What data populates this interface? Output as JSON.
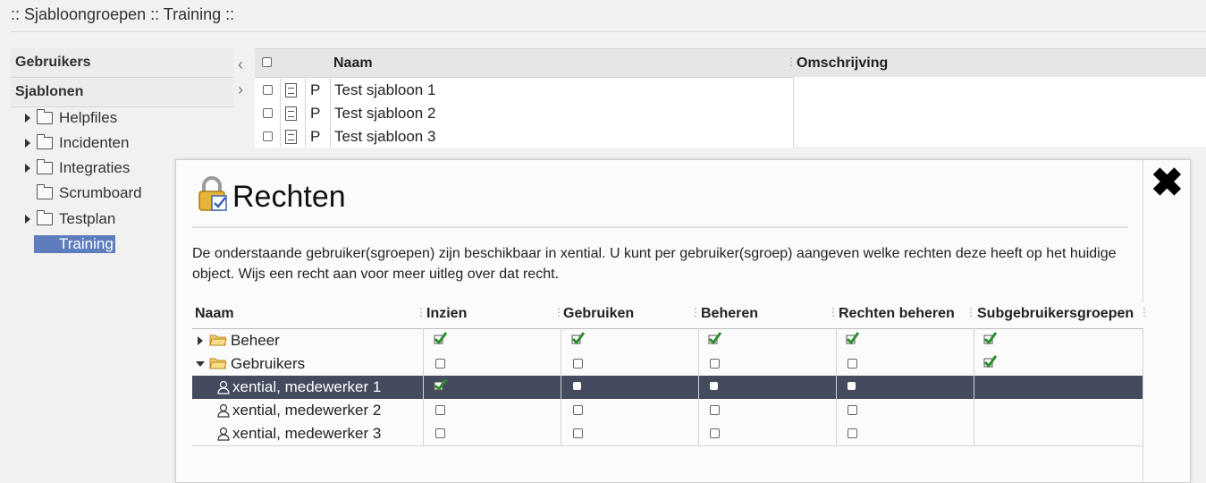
{
  "breadcrumb": ":: Sjabloongroepen :: Training ::",
  "nav": {
    "headers": [
      "Gebruikers",
      "Sjablonen"
    ],
    "tree": [
      {
        "label": "Helpfiles",
        "expandable": true
      },
      {
        "label": "Incidenten",
        "expandable": true
      },
      {
        "label": "Integraties",
        "expandable": true
      },
      {
        "label": "Scrumboard",
        "expandable": false
      },
      {
        "label": "Testplan",
        "expandable": true
      },
      {
        "label": "Training",
        "expandable": false,
        "selected": true
      }
    ]
  },
  "grid": {
    "columns": {
      "name": "Naam",
      "description": "Omschrijving"
    },
    "rows": [
      {
        "type": "P",
        "name": "Test sjabloon 1"
      },
      {
        "type": "P",
        "name": "Test sjabloon 2"
      },
      {
        "type": "P",
        "name": "Test sjabloon 3"
      }
    ]
  },
  "dialog": {
    "title": "Rechten",
    "description": "De onderstaande gebruiker(sgroepen) zijn beschikbaar in xential. U kunt per gebruiker(sgroep) aangeven welke rechten deze heeft op het huidige object. Wijs een recht aan voor meer uitleg over dat recht.",
    "columns": [
      "Naam",
      "Inzien",
      "Gebruiken",
      "Beheren",
      "Rechten beheren",
      "Subgebruikersgroepen"
    ],
    "rows": [
      {
        "name": "Beheer",
        "kind": "group",
        "expanded": false,
        "rights": [
          true,
          true,
          true,
          true,
          true
        ]
      },
      {
        "name": "Gebruikers",
        "kind": "group",
        "expanded": true,
        "rights": [
          false,
          false,
          false,
          false,
          true
        ]
      },
      {
        "name": "xential, medewerker 1",
        "kind": "user",
        "selected": true,
        "rights": [
          true,
          false,
          false,
          false,
          null
        ]
      },
      {
        "name": "xential, medewerker 2",
        "kind": "user",
        "rights": [
          false,
          false,
          false,
          false,
          null
        ]
      },
      {
        "name": "xential, medewerker 3",
        "kind": "user",
        "rights": [
          false,
          false,
          false,
          false,
          null
        ]
      }
    ]
  },
  "colors": {
    "selection": "#5d7dbd",
    "row_selected": "#444b5e",
    "check": "#2e8b2e"
  }
}
